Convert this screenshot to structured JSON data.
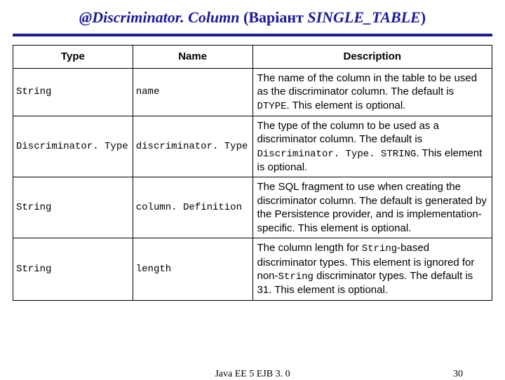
{
  "title": {
    "annotation": "@Discriminator. Column",
    "paren_open": " (",
    "variant": "Варіант ",
    "single_table": "SINGLE_TABLE",
    "paren_close": ")"
  },
  "table": {
    "headers": {
      "type": "Type",
      "name": "Name",
      "description": "Description"
    },
    "rows": [
      {
        "type": "String",
        "name": "name",
        "desc_parts": [
          "The name of the column in the table to be used as the discriminator column. The default is ",
          "DTYPE",
          ". This element is optional."
        ]
      },
      {
        "type": "Discriminator. Type",
        "name": "discriminator. Type",
        "desc_parts": [
          "The type of the column to be used as a discriminator column. The default is ",
          "Discriminator. Type. STRING",
          ". This element is optional."
        ]
      },
      {
        "type": "String",
        "name": "column. Definition",
        "desc_parts": [
          "The SQL fragment to use when creating the discriminator column. The default is generated by the Persistence provider, and is implementation-specific. This element is optional."
        ]
      },
      {
        "type": "String",
        "name": "length",
        "desc_parts": [
          "The column length for ",
          "String",
          "-based discriminator types. This element is ignored for non-",
          "String",
          " discriminator types. The default is 31. This element is optional."
        ]
      }
    ]
  },
  "footer": {
    "center": "Java EE 5 EJB 3. 0",
    "pagenum": "30"
  }
}
